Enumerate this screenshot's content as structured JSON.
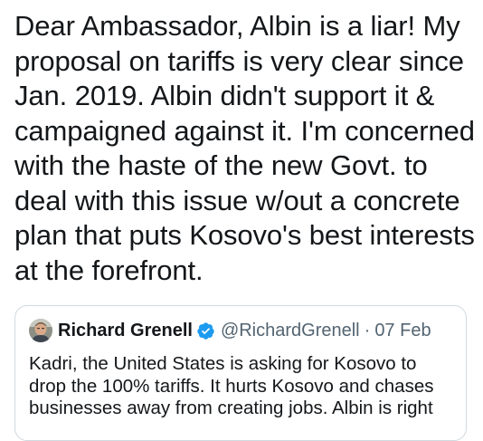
{
  "tweet": {
    "text_lines": [
      "Dear Ambassador, Albin is a liar! My",
      "proposal on tariffs is very clear since",
      "Jan. 2019. Albin didn't support it &",
      "campaigned against it. I'm concerned",
      "with the haste of the new Govt. to",
      "deal with this issue w/out a concrete",
      "plan that puts Kosovo's best interests",
      "at the forefront."
    ]
  },
  "quoted_tweet": {
    "author_name": "Richard Grenell",
    "handle": "@RichardGrenell",
    "separator": "·",
    "date": "07 Feb",
    "verified_icon": "verified-badge-icon",
    "text_lines": [
      "Kadri, the United States is asking for Kosovo to",
      "drop the 100% tariffs. It hurts Kosovo and chases",
      "businesses away from creating jobs. Albin is right"
    ]
  },
  "colors": {
    "text": "#14171a",
    "secondary_text": "#536471",
    "border": "#cfd9de",
    "verified": "#1d9bf0"
  }
}
